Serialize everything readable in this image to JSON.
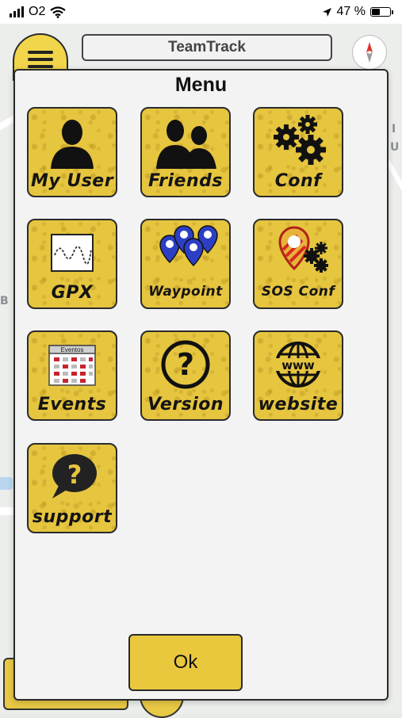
{
  "status_bar": {
    "carrier": "O2",
    "battery": "47 %",
    "battery_level": 0.47
  },
  "app_bar": {
    "title": "TeamTrack"
  },
  "menu": {
    "title": "Menu",
    "items": [
      {
        "label": "My User",
        "icon": "user-icon"
      },
      {
        "label": "Friends",
        "icon": "friends-icon"
      },
      {
        "label": "Conf",
        "icon": "gears-icon"
      },
      {
        "label": "GPX",
        "icon": "gpx-track-icon"
      },
      {
        "label": "Waypoint",
        "icon": "waypoint-pins-icon"
      },
      {
        "label": "SOS Conf",
        "icon": "sos-pin-gears-icon"
      },
      {
        "label": "Events",
        "icon": "calendar-icon"
      },
      {
        "label": "Version",
        "icon": "question-circle-icon"
      },
      {
        "label": "website",
        "icon": "globe-www-icon"
      },
      {
        "label": "support",
        "icon": "speech-bubble-question-icon"
      }
    ],
    "calendar_caption": "Eventos",
    "ok_label": "Ok"
  },
  "colors": {
    "tile_yellow": "#e6c53f",
    "ok_yellow": "#e9c83e",
    "modal_bg": "#f3f3f3",
    "pin_blue": "#2c3fc4",
    "sos_red": "#d62a1f"
  }
}
